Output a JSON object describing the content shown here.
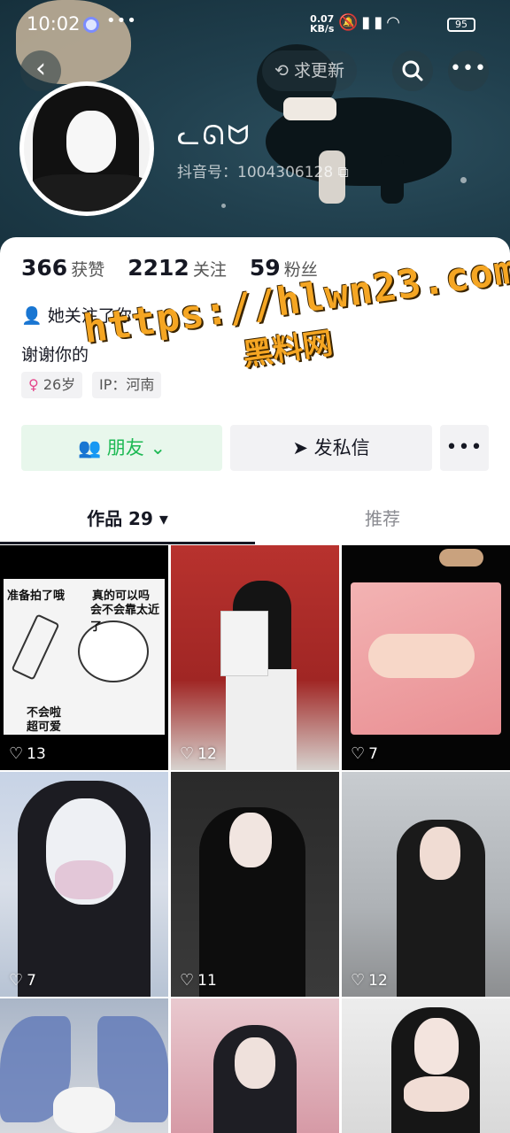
{
  "status_bar": {
    "time": "10:02",
    "net_speed_top": "0.07",
    "net_speed_unit": "KB/s",
    "battery": "95"
  },
  "header": {
    "refresh_label": "求更新",
    "nickname": "ᓚᘏᗢ",
    "douyin_id": "抖音号：1004306128"
  },
  "stats": [
    {
      "value": "366",
      "label": "获赞"
    },
    {
      "value": "2212",
      "label": "关注"
    },
    {
      "value": "59",
      "label": "粉丝"
    }
  ],
  "profile": {
    "follow_note": "她关注了你",
    "bio": "谢谢你的",
    "tag_age": "26岁",
    "tag_ip": "IP：河南"
  },
  "watermark": {
    "line1": "https://hlwn23.com",
    "line2": "黑料网"
  },
  "actions": {
    "friend_label": "朋友",
    "dm_label": "发私信"
  },
  "tabs": {
    "works": "作品 29",
    "recommend": "推荐"
  },
  "posts": [
    {
      "likes": "13",
      "memeText": [
        "准备拍了哦",
        "真的可以吗",
        "会不会靠太近了",
        "不会啦",
        "超可爱"
      ]
    },
    {
      "likes": "12"
    },
    {
      "likes": "7"
    },
    {
      "likes": "7"
    },
    {
      "likes": "11"
    },
    {
      "likes": "12"
    },
    {
      "likes": ""
    },
    {
      "likes": ""
    },
    {
      "likes": ""
    }
  ],
  "colors": {
    "accent_green": "#1db954",
    "friend_bg": "#e8f7ec",
    "watermark": "#f5a623"
  }
}
